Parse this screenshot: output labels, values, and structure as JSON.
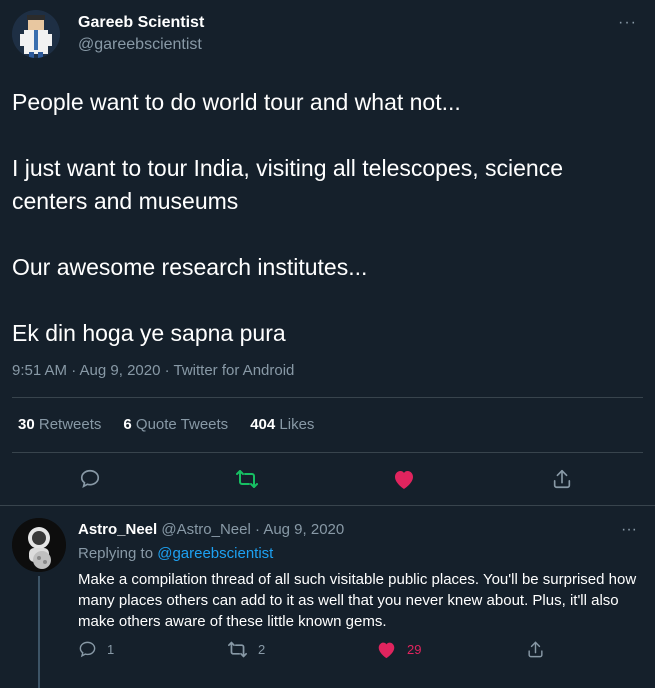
{
  "tweet": {
    "author_name": "Gareeb Scientist",
    "author_handle": "@gareebscientist",
    "more_label": "···",
    "lines": [
      "People want to do world tour and what not...",
      "I just want to tour India, visiting all telescopes, science centers and museums",
      "Our awesome research institutes...",
      "Ek din hoga ye sapna pura"
    ],
    "meta": "9:51 AM · Aug 9, 2020 · Twitter for Android",
    "stats": {
      "retweets_count": "30",
      "retweets_label": "Retweets",
      "quotes_count": "6",
      "quotes_label": "Quote Tweets",
      "likes_count": "404",
      "likes_label": "Likes"
    },
    "icons": [
      "comment-icon",
      "retweet-icon",
      "heart-icon",
      "share-icon"
    ],
    "colors": {
      "retweet": "#17bf63",
      "like": "#e0245e",
      "link": "#1da1f2",
      "background": "#15202b"
    }
  },
  "reply": {
    "author_name": "Astro_Neel",
    "author_handle": "@Astro_Neel",
    "dot": "·",
    "date": "Aug 9, 2020",
    "more_label": "···",
    "replying_prefix": "Replying to",
    "replying_to": "@gareebscientist",
    "text": "Make a compilation thread of all such visitable public places. You'll be surprised how many places others can add to it as well that you never knew about. Plus, it'll also make others aware of these little known gems.",
    "reply_count": "1",
    "retweet_count": "2",
    "like_count": "29"
  }
}
